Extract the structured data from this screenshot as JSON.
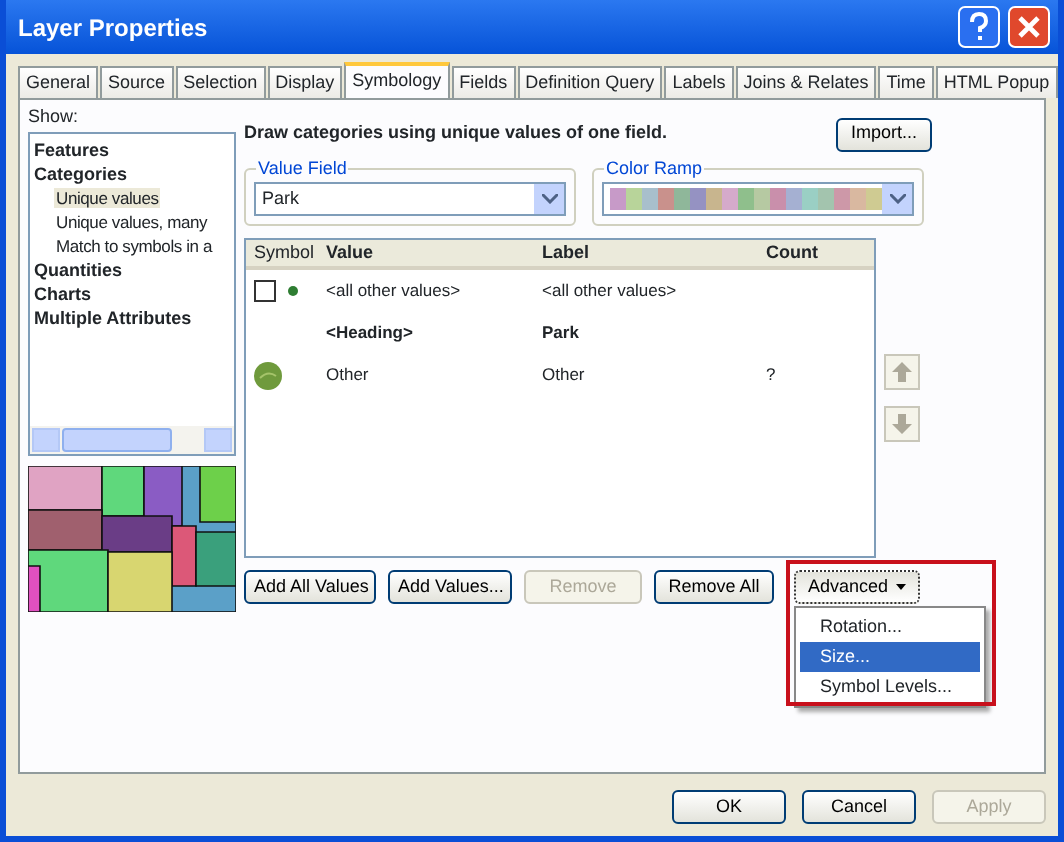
{
  "window": {
    "title": "Layer Properties"
  },
  "tabs": [
    {
      "label": "General",
      "selected": false
    },
    {
      "label": "Source",
      "selected": false
    },
    {
      "label": "Selection",
      "selected": false
    },
    {
      "label": "Display",
      "selected": false
    },
    {
      "label": "Symbology",
      "selected": true
    },
    {
      "label": "Fields",
      "selected": false
    },
    {
      "label": "Definition Query",
      "selected": false
    },
    {
      "label": "Labels",
      "selected": false
    },
    {
      "label": "Joins & Relates",
      "selected": false
    },
    {
      "label": "Time",
      "selected": false
    },
    {
      "label": "HTML Popup",
      "selected": false
    }
  ],
  "show": {
    "label": "Show:",
    "tree": [
      {
        "label": "Features"
      },
      {
        "label": "Categories",
        "children": [
          {
            "label": "Unique values",
            "selected": true
          },
          {
            "label": "Unique values, many",
            "selected": false
          },
          {
            "label": "Match to symbols in a",
            "selected": false
          }
        ]
      },
      {
        "label": "Quantities"
      },
      {
        "label": "Charts"
      },
      {
        "label": "Multiple Attributes"
      }
    ]
  },
  "description": "Draw categories using unique values of one field.",
  "import_button": "Import...",
  "value_field": {
    "legend": "Value Field",
    "value": "Park"
  },
  "color_ramp": {
    "legend": "Color Ramp",
    "swatches": [
      {
        "color": "#c79ac8"
      },
      {
        "color": "#b8d49a"
      },
      {
        "color": "#a8bfcc"
      },
      {
        "color": "#c9918c"
      },
      {
        "color": "#8fb79a"
      },
      {
        "color": "#9592c2"
      },
      {
        "color": "#c8b58e"
      },
      {
        "color": "#d5aacb"
      },
      {
        "color": "#8fbf8c"
      },
      {
        "color": "#b6c9a2"
      },
      {
        "color": "#c98fab"
      },
      {
        "color": "#a5b0d2"
      },
      {
        "color": "#9acfc4"
      },
      {
        "color": "#a3c4ae"
      },
      {
        "color": "#cd98a8"
      },
      {
        "color": "#d9b8a0"
      },
      {
        "color": "#cfcb92"
      }
    ]
  },
  "table": {
    "columns": [
      "Symbol",
      "Value",
      "Label",
      "Count"
    ],
    "rows": [
      {
        "kind": "other",
        "checked": false,
        "value": "<all other values>",
        "label": "<all other values>"
      },
      {
        "kind": "heading",
        "value": "<Heading>",
        "label": "Park"
      },
      {
        "kind": "symbol",
        "value": "Other",
        "label": "Other",
        "count": "?"
      }
    ]
  },
  "buttons": [
    {
      "label": "Add All Values",
      "disabled": false
    },
    {
      "label": "Add Values...",
      "disabled": false
    },
    {
      "label": "Remove",
      "disabled": true
    },
    {
      "label": "Remove All",
      "disabled": false
    }
  ],
  "advanced": {
    "label": "Advanced",
    "expanded": true,
    "menu": [
      {
        "label": "Rotation...",
        "selected": false
      },
      {
        "label": "Size...",
        "selected": true
      },
      {
        "label": "Symbol Levels...",
        "selected": false
      }
    ]
  },
  "dialog_buttons": [
    {
      "label": "OK",
      "disabled": false
    },
    {
      "label": "Cancel",
      "disabled": false
    },
    {
      "label": "Apply",
      "disabled": true
    }
  ]
}
